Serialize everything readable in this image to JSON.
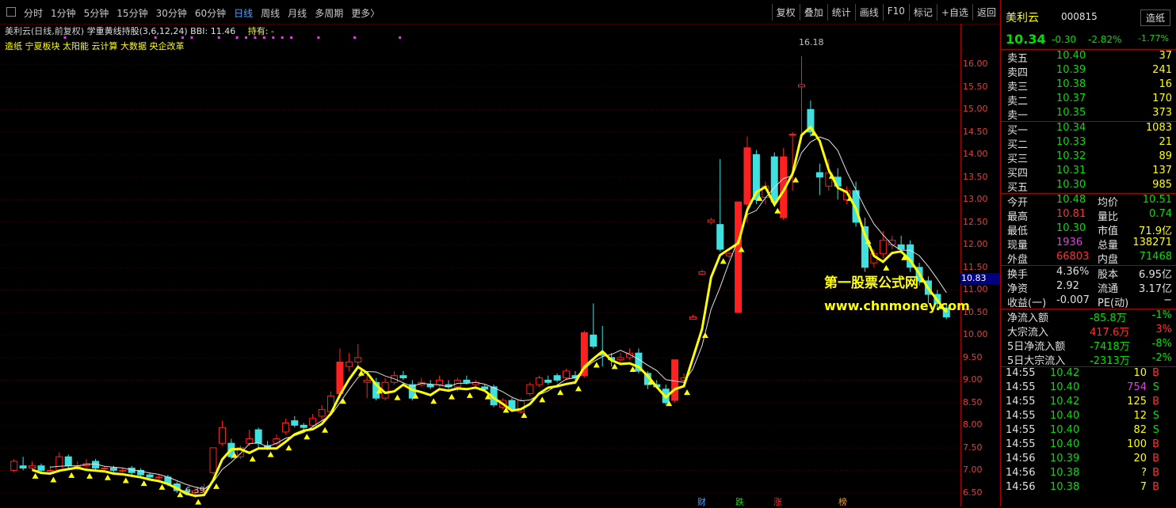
{
  "toolbar": {
    "periods": [
      "分时",
      "1分钟",
      "5分钟",
      "15分钟",
      "30分钟",
      "60分钟",
      "日线",
      "周线",
      "月线",
      "多周期",
      "更多〉"
    ],
    "active_period": "日线",
    "tools": [
      "复权",
      "叠加",
      "统计",
      "画线",
      "F10",
      "标记",
      "+自选",
      "返回"
    ]
  },
  "chart_info": {
    "title": "美利云(日线,前复权)",
    "indicator": "学重黄线持股(3,6,12,24)",
    "bbi": "BBI: 11.46",
    "hold": "持有: -",
    "concepts": "造纸 宁夏板块 太阳能 云计算 大数据 央企改革"
  },
  "axis": {
    "ticks": [
      "16.00",
      "15.50",
      "15.00",
      "14.50",
      "14.00",
      "13.50",
      "13.00",
      "12.50",
      "12.00",
      "11.50",
      "11.00",
      "10.50",
      "10.00",
      "9.50",
      "9.00",
      "8.50",
      "8.00",
      "7.50",
      "7.00",
      "6.50"
    ],
    "current": "10.83",
    "high_label": "16.18",
    "low_label": "6.39"
  },
  "events": [
    {
      "label": "财",
      "color": "#4aa3ff"
    },
    {
      "label": "跌",
      "color": "#00e000"
    },
    {
      "label": "涨",
      "color": "#ff3030"
    },
    {
      "label": "榜",
      "color": "#e0a040"
    }
  ],
  "watermark": {
    "line1": "第一股票公式网",
    "line2": "www.chnmoney.com"
  },
  "colors": {
    "up": "#ff2020",
    "down": "#40e0e0",
    "bbi_line": "#ffff00",
    "ma_line": "#e0e0e0"
  },
  "chart_data": {
    "type": "candlestick",
    "ylim": [
      6.2,
      16.9
    ],
    "candles": [
      [
        7.0,
        7.2,
        7.25,
        6.95
      ],
      [
        7.1,
        7.05,
        7.3,
        7.0
      ],
      [
        7.05,
        7.1,
        7.2,
        7.0
      ],
      [
        7.1,
        7.0,
        7.15,
        6.95
      ],
      [
        7.0,
        7.0,
        7.1,
        6.95
      ],
      [
        7.0,
        7.3,
        7.4,
        6.95
      ],
      [
        7.3,
        7.1,
        7.35,
        7.05
      ],
      [
        7.1,
        7.1,
        7.2,
        7.0
      ],
      [
        7.1,
        7.15,
        7.25,
        7.05
      ],
      [
        7.2,
        7.05,
        7.25,
        7.0
      ],
      [
        7.05,
        7.05,
        7.1,
        7.0
      ],
      [
        7.05,
        7.0,
        7.1,
        6.95
      ],
      [
        7.0,
        7.0,
        7.05,
        6.95
      ],
      [
        7.05,
        6.95,
        7.1,
        6.9
      ],
      [
        7.0,
        6.9,
        7.05,
        6.85
      ],
      [
        6.9,
        6.85,
        6.95,
        6.8
      ],
      [
        6.85,
        6.85,
        6.9,
        6.8
      ],
      [
        6.85,
        6.7,
        6.9,
        6.65
      ],
      [
        6.7,
        6.55,
        6.75,
        6.5
      ],
      [
        6.55,
        6.5,
        6.6,
        6.45
      ],
      [
        6.5,
        6.55,
        6.6,
        6.39
      ],
      [
        6.55,
        6.6,
        6.7,
        6.5
      ],
      [
        6.95,
        7.5,
        7.5,
        6.9
      ],
      [
        7.6,
        7.95,
        8.1,
        7.55
      ],
      [
        7.6,
        7.3,
        7.7,
        7.25
      ],
      [
        7.3,
        7.5,
        7.55,
        7.25
      ],
      [
        7.6,
        7.7,
        7.9,
        7.55
      ],
      [
        7.9,
        7.6,
        7.95,
        7.5
      ],
      [
        7.55,
        7.5,
        7.65,
        7.45
      ],
      [
        7.6,
        7.7,
        7.8,
        7.55
      ],
      [
        7.85,
        8.05,
        8.15,
        7.8
      ],
      [
        8.1,
        8.0,
        8.2,
        7.95
      ],
      [
        8.0,
        7.95,
        8.05,
        7.9
      ],
      [
        8.0,
        8.15,
        8.25,
        7.95
      ],
      [
        8.2,
        8.35,
        8.45,
        8.1
      ],
      [
        8.3,
        8.65,
        8.75,
        8.25
      ],
      [
        8.7,
        9.4,
        9.7,
        8.6
      ],
      [
        9.3,
        9.4,
        9.6,
        9.2
      ],
      [
        9.4,
        9.5,
        9.8,
        9.3
      ],
      [
        8.95,
        9.0,
        9.2,
        8.6
      ],
      [
        8.95,
        8.6,
        9.05,
        8.55
      ],
      [
        8.6,
        8.95,
        9.05,
        8.55
      ],
      [
        8.95,
        9.1,
        9.2,
        8.9
      ],
      [
        9.1,
        9.05,
        9.2,
        9.0
      ],
      [
        8.9,
        8.6,
        9.0,
        8.55
      ],
      [
        8.9,
        8.95,
        9.05,
        8.85
      ],
      [
        8.9,
        8.85,
        9.0,
        8.8
      ],
      [
        8.9,
        9.0,
        9.1,
        8.85
      ],
      [
        8.9,
        8.85,
        9.0,
        8.8
      ],
      [
        8.85,
        9.0,
        9.05,
        8.75
      ],
      [
        9.0,
        8.95,
        9.1,
        8.9
      ],
      [
        8.9,
        8.95,
        9.0,
        8.85
      ],
      [
        8.85,
        8.8,
        8.9,
        8.75
      ],
      [
        8.85,
        8.45,
        8.9,
        8.4
      ],
      [
        8.4,
        8.55,
        8.6,
        8.35
      ],
      [
        8.55,
        8.35,
        8.6,
        8.3
      ],
      [
        8.3,
        8.55,
        8.6,
        8.25
      ],
      [
        8.7,
        8.9,
        8.95,
        8.65
      ],
      [
        8.9,
        9.05,
        9.1,
        8.85
      ],
      [
        9.0,
        8.95,
        9.1,
        8.9
      ],
      [
        9.1,
        9.0,
        9.15,
        8.95
      ],
      [
        9.05,
        9.2,
        9.25,
        9.0
      ],
      [
        9.1,
        9.05,
        9.2,
        9.0
      ],
      [
        9.1,
        10.05,
        10.1,
        9.05
      ],
      [
        10.0,
        9.75,
        10.7,
        9.7
      ],
      [
        9.6,
        9.55,
        10.2,
        9.3
      ],
      [
        9.5,
        9.45,
        9.6,
        9.3
      ],
      [
        9.45,
        9.5,
        9.6,
        9.4
      ],
      [
        9.5,
        9.6,
        9.7,
        9.45
      ],
      [
        9.6,
        9.2,
        9.7,
        9.15
      ],
      [
        9.15,
        8.9,
        9.2,
        8.8
      ],
      [
        8.9,
        8.85,
        9.0,
        8.85
      ],
      [
        8.8,
        8.5,
        8.9,
        8.45
      ],
      [
        8.55,
        9.45,
        9.45,
        8.5
      ],
      [
        9.0,
        9.05,
        9.15,
        8.95
      ],
      [
        10.35,
        10.4,
        10.45,
        10.35
      ],
      [
        11.35,
        11.4,
        11.45,
        11.35
      ],
      [
        12.5,
        12.55,
        12.6,
        12.45
      ],
      [
        12.45,
        11.9,
        13.9,
        11.85
      ],
      [
        11.75,
        11.8,
        11.85,
        11.7
      ],
      [
        10.5,
        12.95,
        12.95,
        10.5
      ],
      [
        12.9,
        14.15,
        14.4,
        12.5
      ],
      [
        14.0,
        13.0,
        14.1,
        12.9
      ],
      [
        13.05,
        13.3,
        13.4,
        12.9
      ],
      [
        13.95,
        12.95,
        14.05,
        12.85
      ],
      [
        12.6,
        13.95,
        14.15,
        12.55
      ],
      [
        14.45,
        14.45,
        14.5,
        13.2
      ],
      [
        15.5,
        15.55,
        16.18,
        14.4
      ],
      [
        15.0,
        14.5,
        15.2,
        14.4
      ],
      [
        13.6,
        13.5,
        13.8,
        13.1
      ],
      [
        13.3,
        13.6,
        13.9,
        13.2
      ],
      [
        13.5,
        13.3,
        13.7,
        13.0
      ],
      [
        13.0,
        13.2,
        13.3,
        12.9
      ],
      [
        13.2,
        12.5,
        13.4,
        12.4
      ],
      [
        12.4,
        11.5,
        12.6,
        11.4
      ],
      [
        11.6,
        11.8,
        11.9,
        11.5
      ],
      [
        11.8,
        12.1,
        12.3,
        11.7
      ],
      [
        12.0,
        12.1,
        12.2,
        11.9
      ],
      [
        12.0,
        11.9,
        12.2,
        11.8
      ],
      [
        12.0,
        11.5,
        12.1,
        11.4
      ],
      [
        11.5,
        11.2,
        11.6,
        11.1
      ],
      [
        11.2,
        10.9,
        11.3,
        10.7
      ],
      [
        10.9,
        10.7,
        11.0,
        10.6
      ],
      [
        10.6,
        10.4,
        10.7,
        10.35
      ]
    ]
  },
  "quote": {
    "name": "美利云",
    "code": "000815",
    "btn": "造纸",
    "price": "10.34",
    "change": "-0.30",
    "pct": "-2.82%",
    "rate": "-1.77%",
    "asks": [
      [
        "卖五",
        "10.40",
        "37"
      ],
      [
        "卖四",
        "10.39",
        "241"
      ],
      [
        "卖三",
        "10.38",
        "16"
      ],
      [
        "卖二",
        "10.37",
        "170"
      ],
      [
        "卖一",
        "10.35",
        "373"
      ]
    ],
    "bids": [
      [
        "买一",
        "10.34",
        "1083"
      ],
      [
        "买二",
        "10.33",
        "21"
      ],
      [
        "买三",
        "10.32",
        "89"
      ],
      [
        "买四",
        "10.31",
        "137"
      ],
      [
        "买五",
        "10.30",
        "985"
      ]
    ],
    "stats": [
      [
        "今开",
        "10.48",
        "均价",
        "10.51"
      ],
      [
        "最高",
        "10.81",
        "量比",
        "0.74"
      ],
      [
        "最低",
        "10.30",
        "市值",
        "71.9亿"
      ],
      [
        "现量",
        "1936",
        "总量",
        "138271"
      ],
      [
        "外盘",
        "66803",
        "内盘",
        "71468"
      ]
    ],
    "stats2": [
      [
        "换手",
        "4.36%",
        "股本",
        "6.95亿"
      ],
      [
        "净资",
        "2.92",
        "流通",
        "3.17亿"
      ],
      [
        "收益(一)",
        "-0.007",
        "PE(动)",
        "−"
      ]
    ],
    "flows": [
      [
        "净流入额",
        "-85.8万",
        "-1%"
      ],
      [
        "大宗流入",
        "417.6万",
        "3%"
      ],
      [
        "5日净流入额",
        "-7418万",
        "-8%"
      ],
      [
        "5日大宗流入",
        "-2313万",
        "-2%"
      ]
    ],
    "ticks": [
      [
        "14:55",
        "10.42",
        "10",
        "B"
      ],
      [
        "14:55",
        "10.40",
        "754",
        "S"
      ],
      [
        "14:55",
        "10.42",
        "125",
        "B"
      ],
      [
        "14:55",
        "10.40",
        "12",
        "S"
      ],
      [
        "14:55",
        "10.40",
        "82",
        "S"
      ],
      [
        "14:55",
        "10.40",
        "100",
        "B"
      ],
      [
        "14:56",
        "10.39",
        "20",
        "B"
      ],
      [
        "14:56",
        "10.38",
        "?",
        "B"
      ],
      [
        "14:56",
        "10.38",
        "7",
        "B"
      ]
    ]
  }
}
